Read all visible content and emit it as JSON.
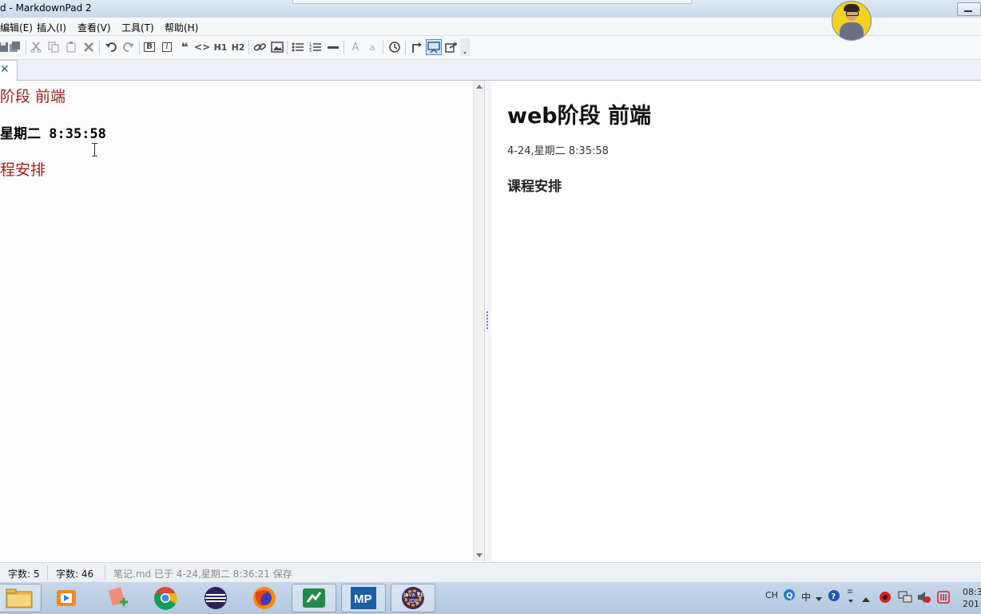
{
  "window": {
    "title": "d - MarkdownPad 2"
  },
  "menu": {
    "items": [
      {
        "label": "编辑(E)"
      },
      {
        "label": "插入(I)"
      },
      {
        "label": "查看(V)"
      },
      {
        "label": "工具(T)"
      },
      {
        "label": "帮助(H)"
      }
    ]
  },
  "toolbar": {
    "heading1_label": "H1",
    "heading2_label": "H2",
    "bold_label": "B",
    "italic_label": "I",
    "quote_label": "❝",
    "code_label": "<>",
    "font_large_label": "A",
    "font_small_label": "a"
  },
  "tabs": {
    "close_glyph": "✕"
  },
  "editor": {
    "lines": [
      {
        "text": "阶段  前端"
      },
      {
        "text": "星期二 8:35:58"
      },
      {
        "text": "程安排"
      }
    ]
  },
  "preview": {
    "heading": "web阶段 前端",
    "date_line": "4-24,星期二 8:35:58",
    "subheading": "课程安排"
  },
  "status": {
    "word_count": "字数: 5",
    "char_count": "字数:  46",
    "saved_message": "笔记.md 已于 4-24,星期二 8:36:21 保存"
  },
  "taskbar": {
    "mp_label": "MP",
    "javaee_label": "Java EE IDE"
  },
  "tray": {
    "lang": "CH",
    "ime": "中",
    "clock": "08:3\n201"
  },
  "colors": {
    "editor_heading": "#9b2121",
    "accent": "#4b8fd2"
  }
}
